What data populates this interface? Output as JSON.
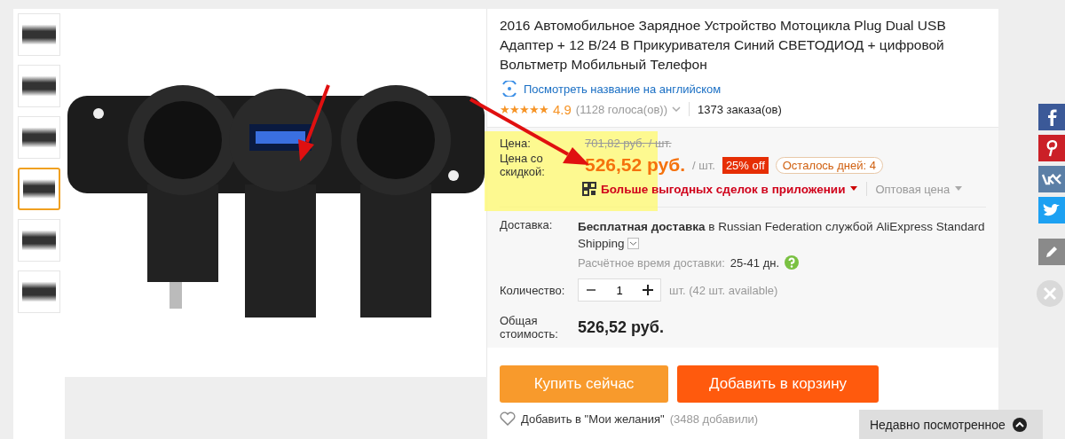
{
  "thumbnails": [
    {
      "selected": false
    },
    {
      "selected": false
    },
    {
      "selected": false
    },
    {
      "selected": true
    },
    {
      "selected": false
    },
    {
      "selected": false
    }
  ],
  "product": {
    "title": "2016 Автомобильное Зарядное Устройство Мотоцикла Plug Dual USB Адаптер + 12 В/24 В Прикуривателя Синий СВЕТОДИОД + цифровой Вольтметр Мобильный Телефон",
    "translate_link": "Посмотреть название на английском",
    "stars": 5,
    "score": "4.9",
    "votes": "(1128 голоса(ов))",
    "orders": "1373 заказа(ов)"
  },
  "price": {
    "label": "Цена:",
    "original": "701,82 руб. / шт.",
    "discount_label": "Цена со скидкой:",
    "discount_price": "526,52 руб.",
    "unit": "/ шт.",
    "discount_badge": "25% off",
    "days_left": "Осталось дней: 4",
    "app_deals": "Больше выгодных сделок в приложении",
    "wholesale": "Оптовая цена"
  },
  "shipping": {
    "label": "Доставка:",
    "method": "**Бесплатная доставка** в Russian Federation службой AliExpress Standard Shipping",
    "estimate_label": "Расчётное время доставки:",
    "estimate": "25-41 дн."
  },
  "quantity": {
    "label": "Количество:",
    "value": "1",
    "note": "шт. (42 шт. available)"
  },
  "total": {
    "label": "Общая стоимость:",
    "value": "526,52 руб."
  },
  "buttons": {
    "buy_now": "Купить сейчас",
    "add_to_cart": "Добавить в корзину"
  },
  "wishlist": {
    "label": "Добавить в \"Мои желания\"",
    "count": "(3488 добавили)"
  },
  "recently_viewed": "Недавно посмотренное"
}
